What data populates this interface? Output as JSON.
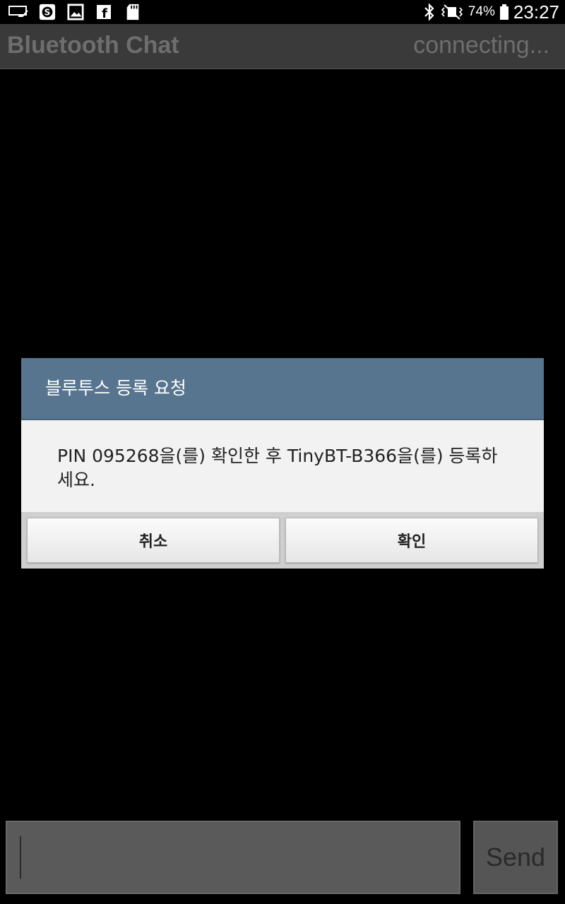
{
  "status_bar": {
    "battery_percent": "74%",
    "time": "23:27",
    "icons": [
      "cast-icon",
      "s-app-icon",
      "gallery-icon",
      "facebook-icon",
      "sd-card-icon",
      "bluetooth-icon",
      "vibrate-icon",
      "battery-icon"
    ]
  },
  "app": {
    "title": "Bluetooth Chat",
    "connection_status": "connecting..."
  },
  "dialog": {
    "title": "블루투스 등록 요청",
    "message": "PIN 095268을(를) 확인한 후 TinyBT-B366을(를) 등록하세요.",
    "cancel_label": "취소",
    "ok_label": "확인"
  },
  "compose": {
    "input_value": "",
    "send_label": "Send"
  },
  "colors": {
    "dialog_header": "#57758f",
    "title_bar": "#3a3a3a"
  }
}
